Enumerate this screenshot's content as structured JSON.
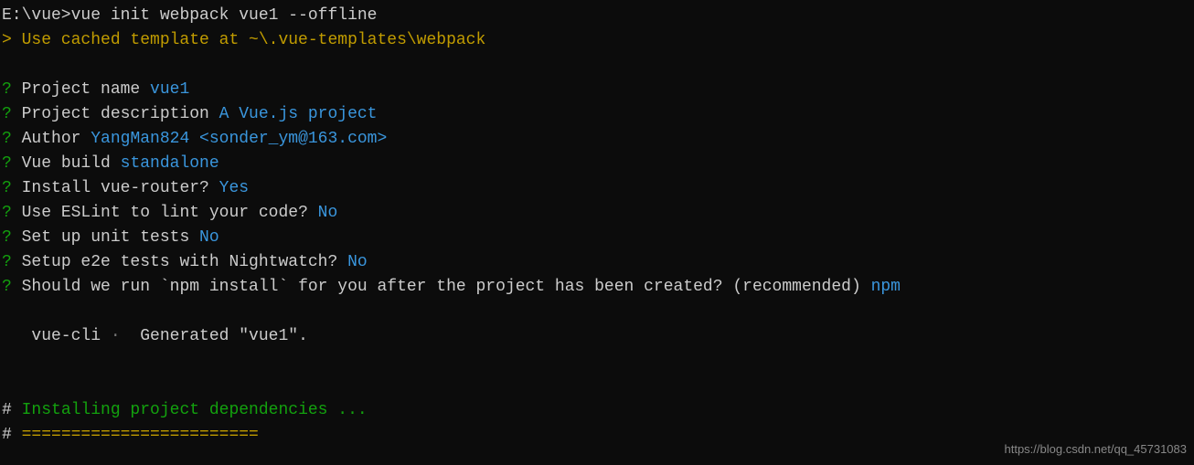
{
  "command": {
    "path": "E:\\vue>",
    "cmd": "vue init webpack vue1 --offline"
  },
  "cached": {
    "prefix": "> Use cached template at ",
    "path": "~\\.vue-templates\\webpack"
  },
  "questions": [
    {
      "mark": "?",
      "label": " Project name ",
      "answer": "vue1"
    },
    {
      "mark": "?",
      "label": " Project description ",
      "answer": "A Vue.js project"
    },
    {
      "mark": "?",
      "label": " Author ",
      "answer": "YangMan824 <sonder_ym@163.com>"
    },
    {
      "mark": "?",
      "label": " Vue build ",
      "answer": "standalone"
    },
    {
      "mark": "?",
      "label": " Install vue-router? ",
      "answer": "Yes"
    },
    {
      "mark": "?",
      "label": " Use ESLint to lint your code? ",
      "answer": "No"
    },
    {
      "mark": "?",
      "label": " Set up unit tests ",
      "answer": "No"
    },
    {
      "mark": "?",
      "label": " Setup e2e tests with Nightwatch? ",
      "answer": "No"
    },
    {
      "mark": "?",
      "label": " Should we run `npm install` for you after the project has been created? (recommended) ",
      "answer": "npm"
    }
  ],
  "generated": {
    "tool": "   vue-cli",
    "bullet": " · ",
    "message": " Generated \"vue1\"."
  },
  "installing": {
    "hash1": "#",
    "text": " Installing project dependencies ...",
    "hash2": "#",
    "divider": " ========================"
  },
  "watermark": "https://blog.csdn.net/qq_45731083"
}
